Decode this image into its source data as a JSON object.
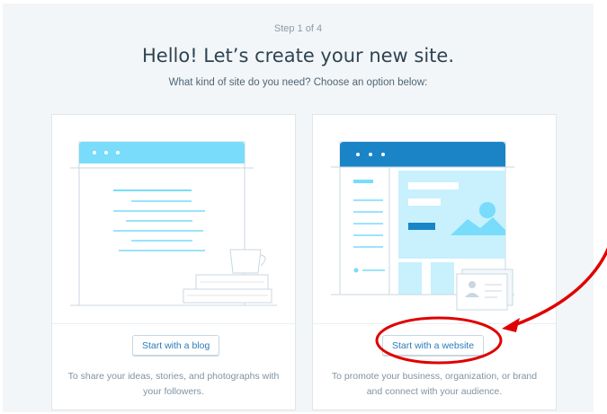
{
  "header": {
    "step": "Step 1 of 4",
    "title": "Hello! Let’s create your new site.",
    "subtitle": "What kind of site do you need? Choose an option below:"
  },
  "options": [
    {
      "button_label": "Start with a blog",
      "description": "To share your ideas, stories, and photographs with your followers."
    },
    {
      "button_label": "Start with a website",
      "description": "To promote your business, organization, or brand and connect with your audience."
    }
  ],
  "annotation": {
    "color": "#e00000"
  },
  "colors": {
    "accent_light": "#6fd0f6",
    "accent_dark": "#1a84c7",
    "button_text": "#2b7bb9",
    "background": "#f3f6f8"
  }
}
